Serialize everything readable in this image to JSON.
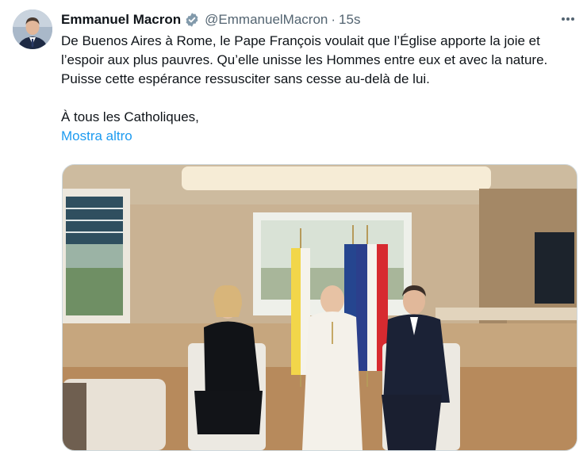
{
  "tweet": {
    "author_name": "Emmanuel Macron",
    "handle": "@EmmanuelMacron",
    "separator": "·",
    "timestamp": "15s",
    "text_line1": "De Buenos Aires à Rome, le Pape François voulait que l’Église apporte la joie et l’espoir aux plus pauvres. Qu’elle unisse les Hommes entre eux et avec la nature. Puisse cette espérance ressusciter sans cesse au-delà de lui.",
    "text_line2": "À tous les Catholiques,",
    "show_more": "Mostra altro"
  },
  "icons": {
    "verified": "verified-badge-icon",
    "more": "more-options-icon"
  },
  "colors": {
    "link": "#1d9bf0",
    "secondary_text": "#536471",
    "primary_text": "#0f1419",
    "verified_badge": "#829aab"
  }
}
